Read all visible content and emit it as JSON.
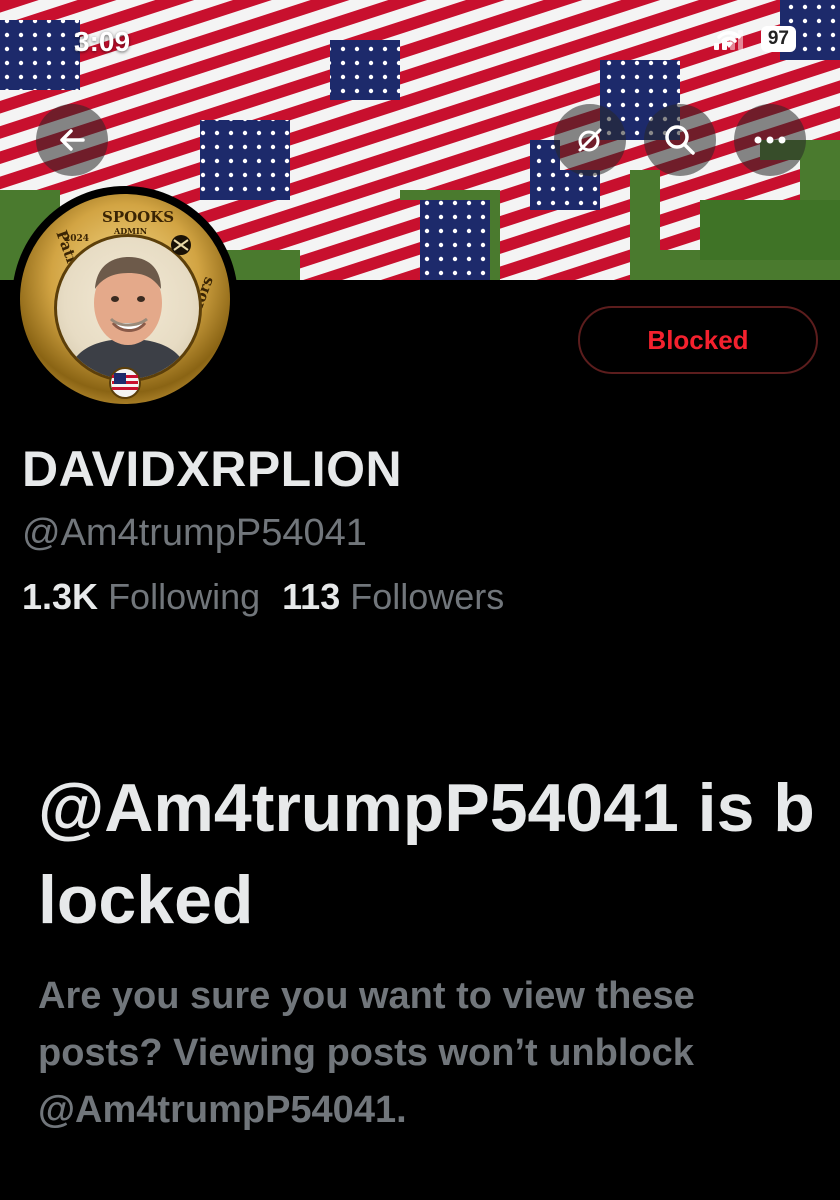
{
  "status_bar": {
    "time": "3:09",
    "battery": "97",
    "icons": [
      "signal-icon",
      "wifi-icon",
      "battery-icon"
    ]
  },
  "header": {
    "back_icon": "arrow-left-icon",
    "grok_icon": "grok-icon",
    "search_icon": "search-icon",
    "more_icon": "more-icon"
  },
  "avatar": {
    "ring_top": "SPOOKS",
    "ring_sub": "ADMIN",
    "ring_year": "2024",
    "ring_left": "Patriot Warriors",
    "ring_right": "Patriot Warriors"
  },
  "profile": {
    "blocked_label": "Blocked",
    "display_name": "DAVIDXRPLION",
    "handle": "@Am4trumpP54041",
    "following_count": "1.3K",
    "following_label": "Following",
    "followers_count": "113",
    "followers_label": "Followers"
  },
  "blocked_notice": {
    "title": "@Am4trumpP54041 is blocked",
    "description": "Are you sure you want to view these posts? Viewing posts won’t unblock @Am4trumpP54041."
  },
  "colors": {
    "background": "#000000",
    "blocked_red": "#f4212e",
    "muted_text": "#71767b",
    "primary_text": "#e7e9ea"
  }
}
